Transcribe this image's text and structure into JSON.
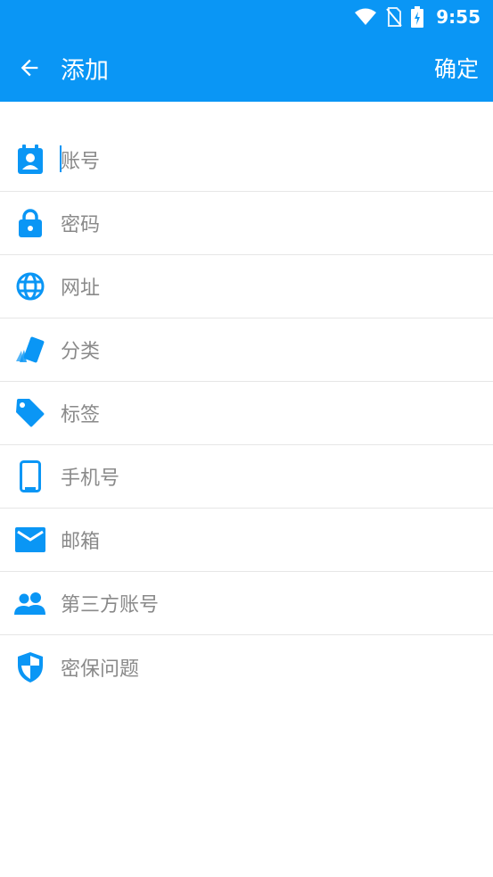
{
  "status_bar": {
    "time": "9:55"
  },
  "app_bar": {
    "title": "添加",
    "confirm_label": "确定"
  },
  "theme": {
    "accent": "#0a96f5",
    "placeholder_text": "#8a8a8a",
    "divider": "#e6e6e6"
  },
  "form": {
    "fields": [
      {
        "icon": "account-icon",
        "label": "账号"
      },
      {
        "icon": "lock-icon",
        "label": "密码"
      },
      {
        "icon": "globe-icon",
        "label": "网址"
      },
      {
        "icon": "category-icon",
        "label": "分类"
      },
      {
        "icon": "tag-icon",
        "label": "标签"
      },
      {
        "icon": "phone-icon",
        "label": "手机号"
      },
      {
        "icon": "mail-icon",
        "label": "邮箱"
      },
      {
        "icon": "people-icon",
        "label": "第三方账号"
      },
      {
        "icon": "shield-icon",
        "label": "密保问题"
      }
    ]
  }
}
